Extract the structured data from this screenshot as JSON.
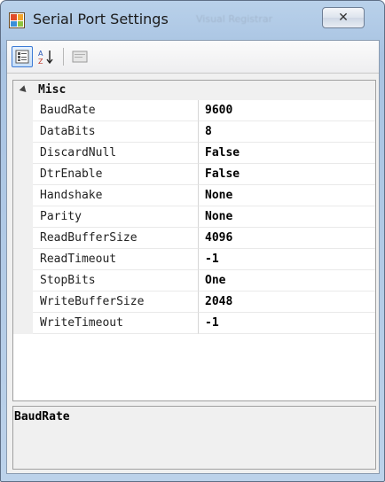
{
  "window": {
    "title": "Serial Port Settings",
    "background_title": "Visual Registrar",
    "close_glyph": "✕"
  },
  "toolbar": {
    "categorized_icon": "categorized-icon",
    "alphabetical_icon": "sort-alphabetical-icon",
    "property_pages_icon": "property-pages-icon"
  },
  "grid": {
    "category": "Misc",
    "properties": [
      {
        "name": "BaudRate",
        "value": "9600"
      },
      {
        "name": "DataBits",
        "value": "8"
      },
      {
        "name": "DiscardNull",
        "value": "False"
      },
      {
        "name": "DtrEnable",
        "value": "False"
      },
      {
        "name": "Handshake",
        "value": "None"
      },
      {
        "name": "Parity",
        "value": "None"
      },
      {
        "name": "ReadBufferSize",
        "value": "4096"
      },
      {
        "name": "ReadTimeout",
        "value": "-1"
      },
      {
        "name": "StopBits",
        "value": "One"
      },
      {
        "name": "WriteBufferSize",
        "value": "2048"
      },
      {
        "name": "WriteTimeout",
        "value": "-1"
      }
    ]
  },
  "description": {
    "title": "BaudRate",
    "text": ""
  },
  "colors": {
    "title_bar": "#b9d1ea",
    "selection_accent": "#3d7bd6",
    "grid_line": "#e9e9e9"
  }
}
